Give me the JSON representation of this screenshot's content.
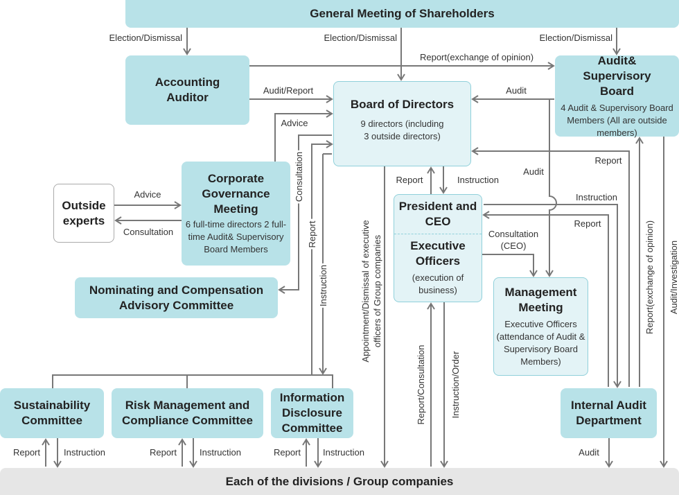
{
  "nodes": {
    "gms": "General Meeting of Shareholders",
    "accounting_auditor": "Accounting Auditor",
    "board": {
      "title": "Board of Directors",
      "sub": "9 directors (including 3 outside directors)"
    },
    "asb": {
      "title": "Audit& Supervisory Board",
      "sub": "4 Audit & Supervisory Board Members (All are outside members)"
    },
    "outside_experts": "Outside experts",
    "cgm": {
      "title": "Corporate Governance Meeting",
      "sub": "6 full-time directors 2 full-time Audit& Supervisory Board Members"
    },
    "nominating": "Nominating and Compensation Advisory Committee",
    "president": "President and CEO",
    "exec": {
      "title": "Executive Officers",
      "sub": "(execution of business)"
    },
    "mgmt": {
      "title": "Management Meeting",
      "sub": "Executive Officers (attendance of Audit & Supervisory Board Members)"
    },
    "sustainability": "Sustainability Committee",
    "risk": "Risk Management and Compliance Committee",
    "info": "Information Disclosure Committee",
    "internal_audit": "Internal Audit Department",
    "divisions": "Each of the divisions / Group companies"
  },
  "labels": {
    "election1": "Election/Dismissal",
    "election2": "Election/Dismissal",
    "election3": "Election/Dismissal",
    "report_exchange": "Report(exchange of opinion)",
    "audit_report": "Audit/Report",
    "advice_board": "Advice",
    "audit_asb": "Audit",
    "advice_oe": "Advice",
    "consultation_oe": "Consultation",
    "consultation_nom": "Consultation",
    "report_comm": "Report",
    "instruction_comm": "Instruction",
    "appointment": "Appointment/Dismissal of executive",
    "appointment2": "officers of Group companies",
    "report_pres": "Report",
    "instruction_pres": "Instruction",
    "audit_mgmt": "Audit",
    "instruction_ia": "Instruction",
    "report_ia": "Report",
    "report_board": "Report",
    "consult_ceo1": "Consultation",
    "consult_ceo2": "(CEO)",
    "report_consultation": "Report/Consultation",
    "instruction_order": "Instruction/Order",
    "report_exchange_ia": "Report(exchange of opinion)",
    "audit_investigation": "Audit/Investigation",
    "audit_ia": "Audit",
    "sus_report": "Report",
    "sus_instruction": "Instruction",
    "risk_report": "Report",
    "risk_instruction": "Instruction",
    "info_report": "Report",
    "info_instruction": "Instruction"
  },
  "colors": {
    "box": "#b8e2e8",
    "box_light": "#e3f3f6",
    "border": "#8fd0da",
    "line": "#777777",
    "bar": "#e6e6e6"
  }
}
